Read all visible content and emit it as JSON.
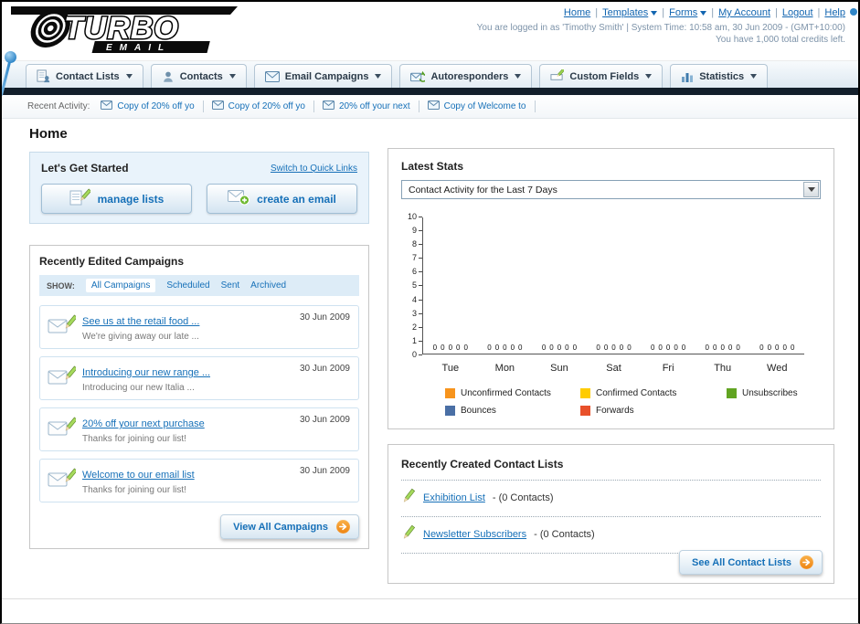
{
  "header": {
    "logo_primary": "TURBO",
    "logo_secondary": "EMAIL",
    "separator": "|",
    "caret_icon": "caret-down-blue-icon",
    "links": [
      {
        "label": "Home"
      },
      {
        "label": "Templates",
        "dropdown": true
      },
      {
        "label": "Forms",
        "dropdown": true
      },
      {
        "label": "My Account"
      },
      {
        "label": "Logout"
      },
      {
        "label": "Help"
      }
    ],
    "session_line": "You are logged in as 'Timothy Smith' | System Time: 10:58 am, 30 Jun 2009 - (GMT+10:00)",
    "credits_line": "You have 1,000 total credits left."
  },
  "nav": {
    "caret_icon": "caret-down-icon",
    "tabs": [
      {
        "label": "Contact Lists",
        "icon": "contact-lists-icon"
      },
      {
        "label": "Contacts",
        "icon": "contacts-icon"
      },
      {
        "label": "Email Campaigns",
        "icon": "email-campaigns-icon"
      },
      {
        "label": "Autoresponders",
        "icon": "autoresponders-icon"
      },
      {
        "label": "Custom Fields",
        "icon": "custom-fields-icon"
      },
      {
        "label": "Statistics",
        "icon": "statistics-icon"
      }
    ]
  },
  "recent_activity": {
    "label": "Recent Activity:",
    "items": [
      {
        "text": "Copy of 20% off yo",
        "icon": "envelope-icon"
      },
      {
        "text": "Copy of 20% off yo",
        "icon": "envelope-icon"
      },
      {
        "text": "20% off your next",
        "icon": "envelope-icon"
      },
      {
        "text": "Copy of Welcome to",
        "icon": "envelope-icon"
      }
    ]
  },
  "page_title": "Home",
  "get_started": {
    "title": "Let's Get Started",
    "switch_link": "Switch to Quick Links",
    "buttons": [
      {
        "label": "manage lists",
        "icon": "manage-lists-icon"
      },
      {
        "label": "create an email",
        "icon": "create-email-icon"
      }
    ]
  },
  "campaigns": {
    "title": "Recently Edited Campaigns",
    "show_label": "SHOW:",
    "filters": [
      {
        "label": "All Campaigns",
        "selected": true
      },
      {
        "label": "Scheduled",
        "selected": false
      },
      {
        "label": "Sent",
        "selected": false
      },
      {
        "label": "Archived",
        "selected": false
      }
    ],
    "item_icon": "campaign-envelope-pencil-icon",
    "items": [
      {
        "title": "See us at the retail food ...",
        "subtitle": "We're giving away our late ...",
        "date": "30 Jun 2009"
      },
      {
        "title": "Introducing our new range ...",
        "subtitle": "Introducing our new Italia ...",
        "date": "30 Jun 2009"
      },
      {
        "title": "20% off your next purchase",
        "subtitle": "Thanks for joining our list!",
        "date": "30 Jun 2009"
      },
      {
        "title": "Welcome to our email list",
        "subtitle": "Thanks for joining our list!",
        "date": "30 Jun 2009"
      }
    ],
    "view_all_label": "View All Campaigns",
    "view_all_icon": "arrow-right-icon"
  },
  "stats": {
    "title": "Latest Stats",
    "dropdown_value": "Contact Activity for the Last 7 Days",
    "select_icon": "select-caret-icon"
  },
  "chart_data": {
    "type": "bar",
    "title": "Contact Activity for the Last 7 Days",
    "categories": [
      "Tue",
      "Mon",
      "Sun",
      "Sat",
      "Fri",
      "Thu",
      "Wed"
    ],
    "series": [
      {
        "name": "Unconfirmed Contacts",
        "color": "#f7941d",
        "values": [
          0,
          0,
          0,
          0,
          0,
          0,
          0
        ]
      },
      {
        "name": "Confirmed Contacts",
        "color": "#ffcc00",
        "values": [
          0,
          0,
          0,
          0,
          0,
          0,
          0
        ]
      },
      {
        "name": "Unsubscribes",
        "color": "#61a422",
        "values": [
          0,
          0,
          0,
          0,
          0,
          0,
          0
        ]
      },
      {
        "name": "Bounces",
        "color": "#4a6fa5",
        "values": [
          0,
          0,
          0,
          0,
          0,
          0,
          0
        ]
      },
      {
        "name": "Forwards",
        "color": "#e8502a",
        "values": [
          0,
          0,
          0,
          0,
          0,
          0,
          0
        ]
      }
    ],
    "ylim": [
      0,
      10
    ],
    "yticks": [
      0,
      1,
      2,
      3,
      4,
      5,
      6,
      7,
      8,
      9,
      10
    ],
    "grid": false,
    "legend_position": "bottom"
  },
  "contact_lists": {
    "title": "Recently Created Contact Lists",
    "item_icon": "pencil-icon",
    "items": [
      {
        "name": "Exhibition List",
        "suffix": " - (0 Contacts)"
      },
      {
        "name": "Newsletter Subscribers",
        "suffix": " - (0 Contacts)"
      }
    ],
    "see_all_label": "See All Contact Lists",
    "see_all_icon": "arrow-right-icon"
  },
  "colors": {
    "link_blue": "#1670b8",
    "accent_orange": "#ee8410",
    "dark_bar": "#131f2b"
  }
}
